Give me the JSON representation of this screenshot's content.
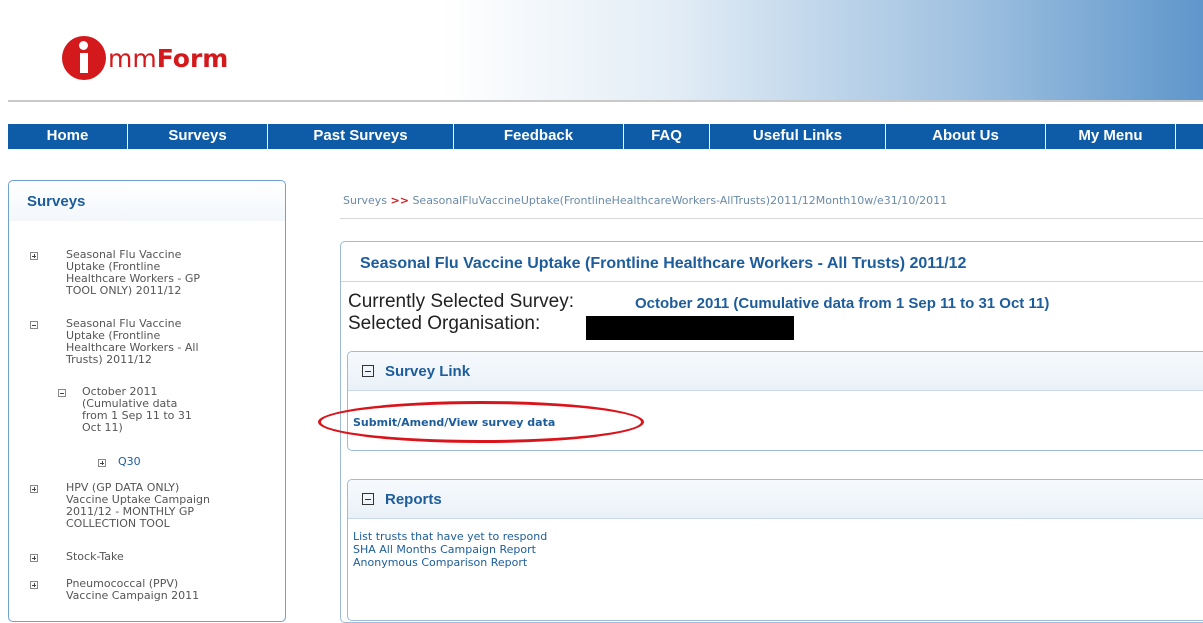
{
  "header": {
    "logo": {
      "letter": "i",
      "text_light": "mm",
      "text_bold": "Form",
      "color": "#d3191b"
    }
  },
  "nav": {
    "items": [
      {
        "label": "Home",
        "width": 120
      },
      {
        "label": "Surveys",
        "width": 140
      },
      {
        "label": "Past Surveys",
        "width": 186
      },
      {
        "label": "Feedback",
        "width": 170
      },
      {
        "label": "FAQ",
        "width": 86
      },
      {
        "label": "Useful Links",
        "width": 176
      },
      {
        "label": "About Us",
        "width": 160
      },
      {
        "label": "My Menu",
        "width": 130
      }
    ],
    "background": "#0e5ca8"
  },
  "sidebar": {
    "title": "Surveys",
    "items": [
      {
        "expander": "plus",
        "lines": [
          "Seasonal Flu Vaccine",
          "Uptake (Frontline",
          "Healthcare Workers - GP",
          "TOOL ONLY) 2011/12"
        ]
      },
      {
        "expander": "minus",
        "lines": [
          "Seasonal Flu Vaccine",
          "Uptake (Frontline",
          "Healthcare Workers - All",
          "Trusts) 2011/12"
        ]
      },
      {
        "expander": "minus",
        "lines": [
          "October 2011",
          "(Cumulative data",
          "from 1 Sep 11 to 31",
          "Oct 11)"
        ]
      },
      {
        "expander": "plus",
        "lines": [
          "Q30"
        ]
      },
      {
        "expander": "plus",
        "lines": [
          "HPV (GP DATA ONLY)",
          "Vaccine Uptake Campaign",
          "2011/12 - MONTHLY GP",
          "COLLECTION TOOL"
        ]
      },
      {
        "expander": "plus",
        "lines": [
          "Stock-Take"
        ]
      },
      {
        "expander": "plus",
        "lines": [
          "Pneumococcal (PPV)",
          "Vaccine Campaign 2011"
        ]
      }
    ]
  },
  "breadcrumb": {
    "root": "Surveys",
    "separator": ">>",
    "current": "SeasonalFluVaccineUptake(FrontlineHealthcareWorkers-AllTrusts)2011/12Month10w/e31/10/2011"
  },
  "main": {
    "title": "Seasonal Flu Vaccine Uptake (Frontline Healthcare Workers - All Trusts) 2011/12",
    "current_survey_label": "Currently Selected Survey:",
    "current_survey_value": "October 2011 (Cumulative data from 1 Sep 11 to 31 Oct 11)",
    "organisation_label": "Selected Organisation:",
    "survey_link_box": {
      "title": "Survey Link",
      "link": "Submit/Amend/View survey data"
    },
    "reports_box": {
      "title": "Reports",
      "links": [
        "List trusts that have yet to respond",
        "SHA All Months Campaign Report",
        "Anonymous Comparison Report"
      ]
    }
  },
  "colors": {
    "brand_red": "#d3191b",
    "link_blue": "#1d5d9c",
    "annotation_red": "#d9141b"
  }
}
